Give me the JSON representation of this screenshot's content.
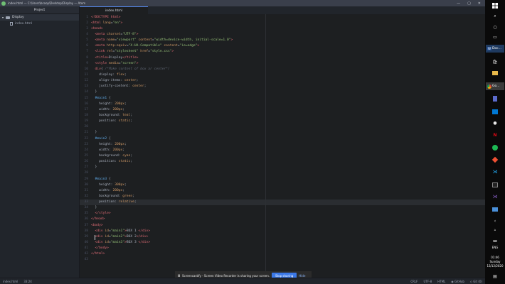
{
  "window": {
    "title": "index.html — C:\\Users\\bcoop\\Desktop\\Display — Atom",
    "minimize": "—",
    "maximize": "▢",
    "close": "✕"
  },
  "tree": {
    "header": "Project",
    "folder": "Display",
    "file": "index.html"
  },
  "tabs": [
    {
      "label": "index.html"
    }
  ],
  "code": [
    {
      "n": "1",
      "segs": [
        [
          "tag",
          "<!DOCTYPE html>"
        ]
      ]
    },
    {
      "n": "2",
      "segs": [
        [
          "tag",
          "<html "
        ],
        [
          "attr",
          "lang"
        ],
        [
          "plain",
          "="
        ],
        [
          "str",
          "\"en\""
        ],
        [
          "tag",
          ">"
        ]
      ]
    },
    {
      "n": "3",
      "segs": [
        [
          "tag",
          "<head>"
        ]
      ]
    },
    {
      "n": "4",
      "segs": [
        [
          "plain",
          "  "
        ],
        [
          "tag",
          "<meta "
        ],
        [
          "attr",
          "charset"
        ],
        [
          "plain",
          "="
        ],
        [
          "str",
          "\"UTF-8\""
        ],
        [
          "tag",
          ">"
        ]
      ]
    },
    {
      "n": "5",
      "segs": [
        [
          "plain",
          "  "
        ],
        [
          "tag",
          "<meta "
        ],
        [
          "attr",
          "name"
        ],
        [
          "plain",
          "="
        ],
        [
          "str",
          "\"viewport\""
        ],
        [
          "attr",
          " content"
        ],
        [
          "plain",
          "="
        ],
        [
          "str",
          "\"width=device-width, initial-scale=1.0\""
        ],
        [
          "tag",
          ">"
        ]
      ]
    },
    {
      "n": "6",
      "segs": [
        [
          "plain",
          "  "
        ],
        [
          "tag",
          "<meta "
        ],
        [
          "attr",
          "http-equiv"
        ],
        [
          "plain",
          "="
        ],
        [
          "str",
          "\"X-UA-Compatible\""
        ],
        [
          "attr",
          " content"
        ],
        [
          "plain",
          "="
        ],
        [
          "str",
          "\"ie=edge\""
        ],
        [
          "tag",
          ">"
        ]
      ]
    },
    {
      "n": "7",
      "segs": [
        [
          "plain",
          "  "
        ],
        [
          "tag",
          "<link "
        ],
        [
          "attr",
          "rel"
        ],
        [
          "plain",
          "="
        ],
        [
          "str",
          "\"stylesheet\""
        ],
        [
          "attr",
          " href"
        ],
        [
          "plain",
          "="
        ],
        [
          "str",
          "\"style.css\""
        ],
        [
          "tag",
          ">"
        ]
      ]
    },
    {
      "n": "8",
      "segs": [
        [
          "plain",
          "  "
        ],
        [
          "tag",
          "<title>"
        ],
        [
          "plain",
          "Display"
        ],
        [
          "tag",
          "</title>"
        ]
      ]
    },
    {
      "n": "9",
      "segs": [
        [
          "plain",
          "  "
        ],
        [
          "tag",
          "<style "
        ],
        [
          "attr",
          "media"
        ],
        [
          "plain",
          "="
        ],
        [
          "str",
          "\"screen\""
        ],
        [
          "tag",
          ">"
        ]
      ]
    },
    {
      "n": "10",
      "segs": [
        [
          "plain",
          "  "
        ],
        [
          "tag",
          "div"
        ],
        [
          "plain",
          "{ "
        ],
        [
          "comment",
          "/*Make content of box ar center*/"
        ]
      ]
    },
    {
      "n": "11",
      "segs": [
        [
          "plain",
          "    display: "
        ],
        [
          "val",
          "flex"
        ],
        [
          "plain",
          ";"
        ]
      ]
    },
    {
      "n": "12",
      "segs": [
        [
          "plain",
          "    align-items: "
        ],
        [
          "val",
          "center"
        ],
        [
          "plain",
          ";"
        ]
      ]
    },
    {
      "n": "13",
      "segs": [
        [
          "plain",
          "    justify-content: "
        ],
        [
          "val",
          "center"
        ],
        [
          "plain",
          ";"
        ]
      ]
    },
    {
      "n": "14",
      "segs": [
        [
          "plain",
          "  }"
        ]
      ]
    },
    {
      "n": "15",
      "segs": [
        [
          "plain",
          "  "
        ],
        [
          "sel",
          "#main1"
        ],
        [
          "plain",
          " {"
        ]
      ]
    },
    {
      "n": "16",
      "segs": [
        [
          "plain",
          "    height: "
        ],
        [
          "val",
          "200px"
        ],
        [
          "plain",
          ";"
        ]
      ]
    },
    {
      "n": "17",
      "segs": [
        [
          "plain",
          "    width: "
        ],
        [
          "val",
          "200px"
        ],
        [
          "plain",
          ";"
        ]
      ]
    },
    {
      "n": "18",
      "segs": [
        [
          "plain",
          "    background: "
        ],
        [
          "val",
          "teal"
        ],
        [
          "plain",
          ";"
        ]
      ]
    },
    {
      "n": "19",
      "segs": [
        [
          "plain",
          "    position: "
        ],
        [
          "val",
          "static"
        ],
        [
          "plain",
          ";"
        ]
      ]
    },
    {
      "n": "20",
      "segs": [
        [
          "plain",
          ""
        ]
      ]
    },
    {
      "n": "21",
      "segs": [
        [
          "plain",
          "  }"
        ]
      ]
    },
    {
      "n": "22",
      "segs": [
        [
          "plain",
          "  "
        ],
        [
          "sel",
          "#main2"
        ],
        [
          "plain",
          " {"
        ]
      ]
    },
    {
      "n": "23",
      "segs": [
        [
          "plain",
          "    height: "
        ],
        [
          "val",
          "200px"
        ],
        [
          "plain",
          ";"
        ]
      ]
    },
    {
      "n": "24",
      "segs": [
        [
          "plain",
          "    width: "
        ],
        [
          "val",
          "200px"
        ],
        [
          "plain",
          ";"
        ]
      ]
    },
    {
      "n": "25",
      "segs": [
        [
          "plain",
          "    background: "
        ],
        [
          "val",
          "cyan"
        ],
        [
          "plain",
          ";"
        ]
      ]
    },
    {
      "n": "26",
      "segs": [
        [
          "plain",
          "    position: "
        ],
        [
          "val",
          "static"
        ],
        [
          "plain",
          ";"
        ]
      ]
    },
    {
      "n": "27",
      "segs": [
        [
          "plain",
          "  }"
        ]
      ]
    },
    {
      "n": "28",
      "segs": [
        [
          "plain",
          ""
        ]
      ]
    },
    {
      "n": "29",
      "segs": [
        [
          "plain",
          "  "
        ],
        [
          "sel",
          "#main3"
        ],
        [
          "plain",
          " {"
        ]
      ]
    },
    {
      "n": "30",
      "segs": [
        [
          "plain",
          "    height: "
        ],
        [
          "val",
          "300px"
        ],
        [
          "plain",
          ";"
        ]
      ]
    },
    {
      "n": "31",
      "segs": [
        [
          "plain",
          "    width: "
        ],
        [
          "val",
          "200px"
        ],
        [
          "plain",
          ";"
        ]
      ]
    },
    {
      "n": "32",
      "segs": [
        [
          "plain",
          "    background: "
        ],
        [
          "val",
          "green"
        ],
        [
          "plain",
          ";"
        ]
      ]
    },
    {
      "n": "33",
      "segs": [
        [
          "plain",
          "    position: "
        ],
        [
          "val",
          "relative"
        ],
        [
          "plain",
          ";"
        ]
      ],
      "cursor": true
    },
    {
      "n": "34",
      "segs": [
        [
          "plain",
          "  }"
        ]
      ]
    },
    {
      "n": "35",
      "segs": [
        [
          "plain",
          "  "
        ],
        [
          "tag",
          "</style>"
        ]
      ]
    },
    {
      "n": "36",
      "segs": [
        [
          "tag",
          "</head>"
        ]
      ]
    },
    {
      "n": "37",
      "segs": [
        [
          "tag",
          "<body>"
        ]
      ]
    },
    {
      "n": "38",
      "segs": [
        [
          "plain",
          "  "
        ],
        [
          "tag",
          "<div "
        ],
        [
          "attr",
          "id"
        ],
        [
          "plain",
          "="
        ],
        [
          "str",
          "\"main1\""
        ],
        [
          "tag",
          ">"
        ],
        [
          "plain",
          "BOX 1 "
        ],
        [
          "tag",
          "</div>"
        ]
      ]
    },
    {
      "n": "39",
      "segs": [
        [
          "plain",
          "  "
        ],
        [
          "tag",
          "<div "
        ],
        [
          "attr",
          "id"
        ],
        [
          "plain",
          "="
        ],
        [
          "str",
          "\"main2\""
        ],
        [
          "tag",
          ">"
        ],
        [
          "plain",
          "BOX 2"
        ],
        [
          "tag",
          "</div>"
        ]
      ]
    },
    {
      "n": "40",
      "segs": [
        [
          "plain",
          "  "
        ],
        [
          "tag",
          "<div "
        ],
        [
          "attr",
          "id"
        ],
        [
          "plain",
          "="
        ],
        [
          "str",
          "\"main3\""
        ],
        [
          "tag",
          ">"
        ],
        [
          "plain",
          "BOX 3 "
        ],
        [
          "tag",
          "</div>"
        ]
      ]
    },
    {
      "n": "41",
      "segs": [
        [
          "plain",
          "  "
        ],
        [
          "tag",
          "</body>"
        ]
      ]
    },
    {
      "n": "42",
      "segs": [
        [
          "tag",
          "</html>"
        ]
      ]
    },
    {
      "n": "43",
      "segs": [
        [
          "plain",
          ""
        ]
      ]
    }
  ],
  "status": {
    "file": "index.html",
    "position": "33:24",
    "line_ending": "CRLF",
    "encoding": "UTF-8",
    "grammar": "HTML",
    "github": "GitHub",
    "git": "Git (0)"
  },
  "share": {
    "message": "Screencastify - Screen Video Recorder is sharing your screen.",
    "stop": "Stop sharing",
    "hide": "Hide",
    "pause_icon": "II"
  },
  "taskbar": {
    "word_label": "Doc...",
    "chrome_label": "Go...",
    "clock_time": "01:46",
    "clock_day": "Sunday",
    "clock_date": "13/12/2020",
    "lang": "ENG"
  },
  "colors": {
    "accent": "#568af2",
    "editor_bg": "#1d1f21",
    "share_button": "#3b78e7"
  }
}
